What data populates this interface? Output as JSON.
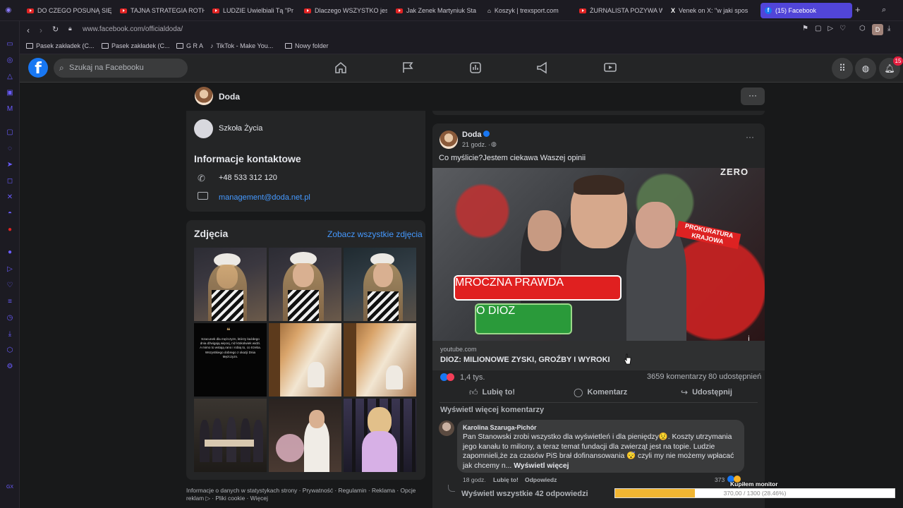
{
  "browser": {
    "tabs": [
      {
        "label": "DO CZEGO POSUNĄ SIĘ",
        "type": "yt"
      },
      {
        "label": "TAJNA STRATEGIA ROTH",
        "type": "yt"
      },
      {
        "label": "LUDZIE Uwielbiali Tą \"Pr",
        "type": "yt"
      },
      {
        "label": "Dlaczego WSZYSTKO jes",
        "type": "yt"
      },
      {
        "label": "Jak Zenek Martyniuk Sta",
        "type": "yt"
      },
      {
        "label": "Koszyk | trexsport.com",
        "type": "shop"
      },
      {
        "label": "ŻURNALISTA POZYWA W",
        "type": "yt"
      },
      {
        "label": "Venek on X: \"w jaki spos",
        "type": "x"
      },
      {
        "label": "(15) Facebook",
        "type": "fb"
      }
    ],
    "url": "www.facebook.com/officialdoda/",
    "bookmarks": [
      "Pasek zakładek (C...",
      "Pasek zakładek (C...",
      "G R A",
      "TikTok - Make You...",
      "Nowy folder"
    ],
    "profile_letter": "D"
  },
  "facebook": {
    "search_placeholder": "Szukaj na Facebooku",
    "notifications_count": "15",
    "page_name": "Doda",
    "intro": {
      "school": "Szkoła Życia",
      "contact_heading": "Informacje kontaktowe",
      "phone": "+48 533 312 120",
      "email": "management@doda.net.pl"
    },
    "photos": {
      "heading": "Zdjęcia",
      "see_all": "Zobacz wszystkie zdjęcia",
      "quote_card": "Szacunek dla mężczyzn, którzy każdego dnia dźwigają więcej, niż ktokolwiek widzi. A mimo to wstają rano i robią to, co trzeba. Wszystkiego dobrego z okazji Dnia Mężczyzn."
    },
    "footer_links": "Informacje o danych w statystykach strony · Prywatność · Regulamin · Reklama · Opcje reklam ▷ · Pliki cookie · Więcej",
    "post": {
      "author": "Doda",
      "time": "21 godz. ·",
      "text": "Co myślicie?Jestem ciekawa Waszej opinii",
      "thumb_title_line1": "MROCZNA PRAWDA",
      "thumb_title_line2": "O DIOZ",
      "thumb_sign": "PROKURATURA KRAJOWA",
      "thumb_brand": "ZERO",
      "link_domain": "youtube.com",
      "link_title": "DIOZ: MILIONOWE ZYSKI, GROŹBY I WYROKI",
      "reactions": "1,4 tys.",
      "comments_count": "3659 komentarzy",
      "shares_count": "80 udostępnień",
      "like_label": "Lubię to!",
      "comment_label": "Komentarz",
      "share_label": "Udostępnij",
      "more_comments": "Wyświetl więcej komentarzy",
      "comment": {
        "author": "Karolina Szaruga-Pichór",
        "text": "Pan Stanowski zrobi wszystko dla wyświetleń i dla pieniędzy😟. Koszty utrzymania jego kanału to miliony, a teraz temat fundacji dla zwierząt jest na topie. Ludzie zapomnieli,że za czasów PiS brał dofinansowania 😴 czyli my nie możemy wpłacać jak chcemy n...",
        "see_more": "Wyświetl więcej",
        "time": "18 godz.",
        "like": "Lubię to!",
        "reply": "Odpowiedz",
        "reaction_count": "373",
        "view_replies": "Wyświetl wszystkie 42 odpowiedzi"
      }
    }
  },
  "overlay": {
    "label": "Kupiłem monitor",
    "progress_text": "370,00 / 1300 (28.46%)",
    "progress_fraction": 0.2846
  }
}
